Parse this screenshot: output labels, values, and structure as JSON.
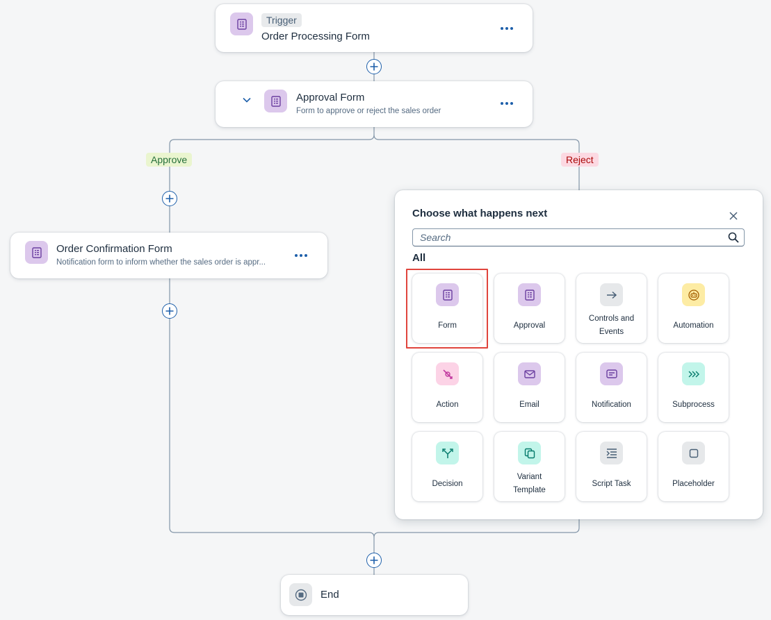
{
  "trigger_card": {
    "badge": "Trigger",
    "title": "Order Processing Form"
  },
  "approval_card": {
    "title": "Approval Form",
    "subtitle": "Form to approve or reject the sales order"
  },
  "branches": {
    "approve": "Approve",
    "reject": "Reject"
  },
  "order_confirmation_card": {
    "title": "Order Confirmation Form",
    "subtitle": "Notification form to inform whether the sales order is appr..."
  },
  "end_card": {
    "title": "End"
  },
  "popover": {
    "title": "Choose what happens next",
    "search_placeholder": "Search",
    "section_label": "All",
    "tiles": [
      {
        "label_1": "Form",
        "label_2": "",
        "icon": "form-icon",
        "tone": "purple"
      },
      {
        "label_1": "Approval",
        "label_2": "",
        "icon": "approval-icon",
        "tone": "purple"
      },
      {
        "label_1": "Controls and",
        "label_2": "Events",
        "icon": "arrow-right-icon",
        "tone": "grey"
      },
      {
        "label_1": "Automation",
        "label_2": "",
        "icon": "robot-icon",
        "tone": "yellow"
      },
      {
        "label_1": "Action",
        "label_2": "",
        "icon": "action-icon",
        "tone": "pink"
      },
      {
        "label_1": "Email",
        "label_2": "",
        "icon": "email-icon",
        "tone": "purple"
      },
      {
        "label_1": "Notification",
        "label_2": "",
        "icon": "notification-icon",
        "tone": "purple"
      },
      {
        "label_1": "Subprocess",
        "label_2": "",
        "icon": "subprocess-icon",
        "tone": "teal"
      },
      {
        "label_1": "Decision",
        "label_2": "",
        "icon": "decision-icon",
        "tone": "teal"
      },
      {
        "label_1": "Variant",
        "label_2": "Template",
        "icon": "variant-template-icon",
        "tone": "teal"
      },
      {
        "label_1": "Script Task",
        "label_2": "",
        "icon": "script-task-icon",
        "tone": "grey"
      },
      {
        "label_1": "Placeholder",
        "label_2": "",
        "icon": "placeholder-icon",
        "tone": "grey"
      }
    ]
  },
  "colors": {
    "accent": "#1d5faa",
    "highlight": "#e0443c",
    "connector": "#8396a8"
  }
}
